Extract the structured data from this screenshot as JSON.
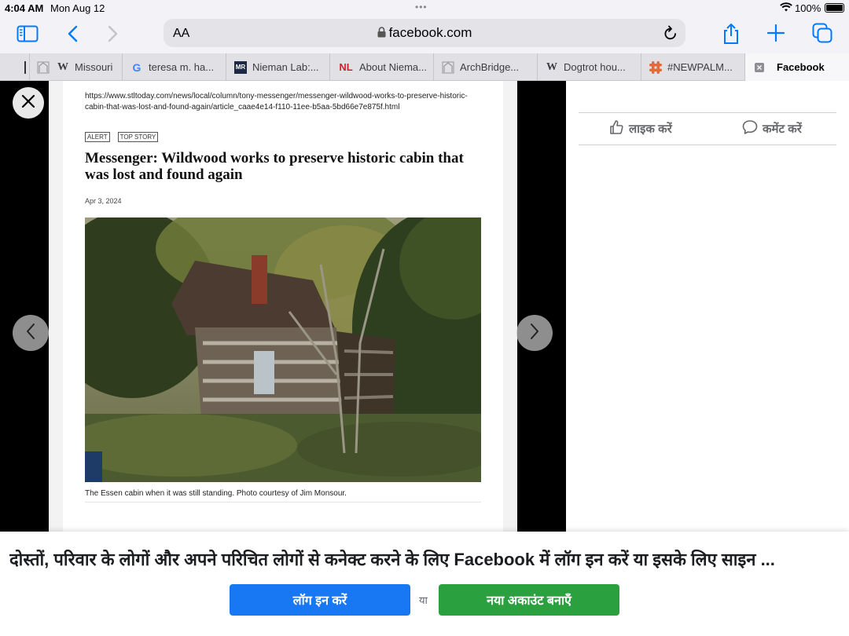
{
  "status_bar": {
    "time": "4:04 AM",
    "date": "Mon Aug 12",
    "battery_percent": "100%",
    "battery_level": 1.0,
    "icons": [
      "wifi-icon",
      "battery-icon"
    ]
  },
  "toolbar": {
    "text_size_label": "AA",
    "url": "facebook.com",
    "icons": [
      "sidebar-icon",
      "back-icon",
      "forward-icon",
      "lock-icon",
      "reload-icon",
      "share-icon",
      "new-tab-icon",
      "tabs-icon"
    ]
  },
  "tabs": [
    {
      "label": "",
      "favicon": "pin-tab-icon"
    },
    {
      "label": "Missouri",
      "favicon": "wikipedia-icon",
      "favicon_text": "W"
    },
    {
      "label": "teresa m. ha...",
      "favicon": "google-icon",
      "favicon_text": "G"
    },
    {
      "label": "Nieman Lab:...",
      "favicon": "mr-icon",
      "favicon_text": "MR"
    },
    {
      "label": "About Niema...",
      "favicon": "nl-icon",
      "favicon_text": "NL"
    },
    {
      "label": "ArchBridge...",
      "favicon": "arch-icon",
      "favicon_text": ""
    },
    {
      "label": "Dogtrot hou...",
      "favicon": "wikipedia-icon",
      "favicon_text": "W"
    },
    {
      "label": "#NEWPALM...",
      "favicon": "slack-icon",
      "favicon_text": ""
    },
    {
      "label": "Facebook",
      "favicon": "close-tab-icon",
      "favicon_text": "",
      "active": true
    }
  ],
  "article": {
    "url": "https://www.stltoday.com/news/local/column/tony-messenger/messenger-wildwood-works-to-preserve-historic-cabin-that-was-lost-and-found-again/article_caae4e14-f110-11ee-b5aa-5bd66e7e875f.html",
    "tags": [
      "ALERT",
      "TOP STORY"
    ],
    "title": "Messenger: Wildwood works to preserve historic cabin that was lost and found again",
    "date": "Apr 3, 2024",
    "caption": "The Essen cabin when it was still standing. Photo courtesy of Jim Monsour."
  },
  "actions": {
    "like_label": "लाइक करें",
    "comment_label": "कमेंट करें"
  },
  "login_banner": {
    "text": "दोस्तों, परिवार के लोगों और अपने परिचित लोगों से कनेक्ट करने के लिए Facebook में लॉग इन करें या इसके लिए साइन ...",
    "login_label": "लॉग इन करें",
    "or_label": "या",
    "signup_label": "नया अकाउंट बनाएँ"
  },
  "colors": {
    "accent_blue": "#007aff",
    "facebook_blue": "#1877f2",
    "signup_green": "#2aa13e",
    "viewer_bg": "#000000"
  }
}
